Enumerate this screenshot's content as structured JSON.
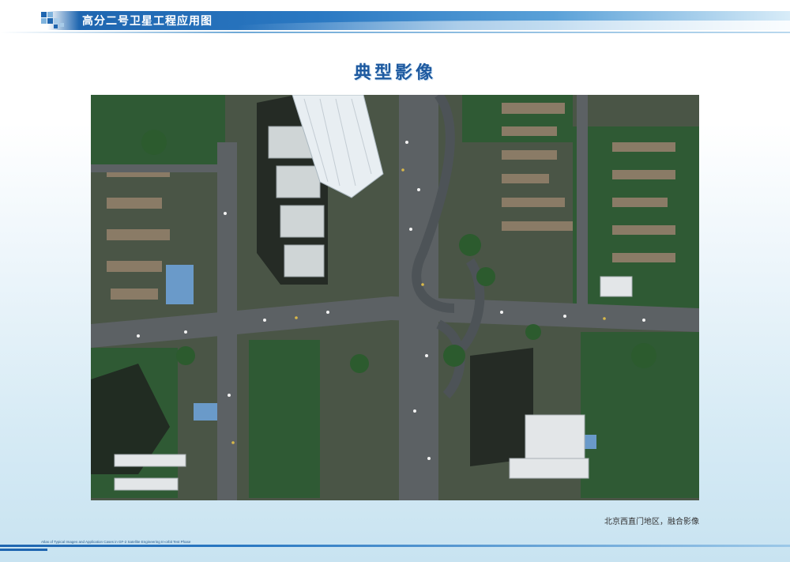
{
  "header": {
    "title": "高分二号卫星工程应用图"
  },
  "page": {
    "title": "典型影像"
  },
  "image": {
    "caption": "北京西直门地区，融合影像"
  },
  "footer": {
    "text": "Atlas of Typical Images and Application Cases in GF-2 Satellite Engineering In-orbit Test Phase"
  },
  "colors": {
    "brand_blue": "#1f66b0",
    "title_blue": "#1e5aa0"
  }
}
